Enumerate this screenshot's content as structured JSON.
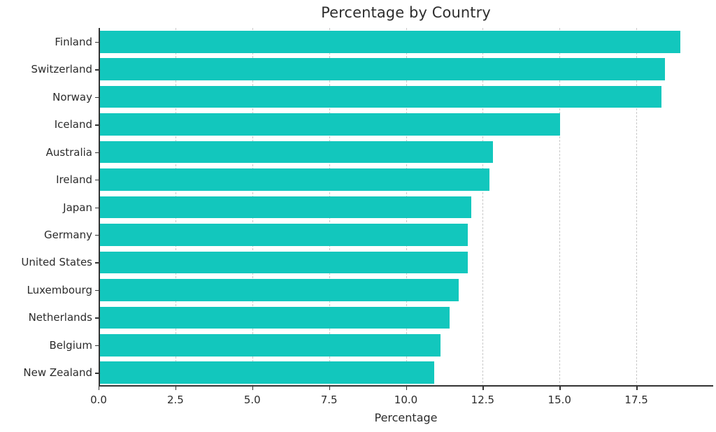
{
  "chart_data": {
    "type": "bar",
    "orientation": "horizontal",
    "title": "Percentage by Country",
    "xlabel": "Percentage",
    "ylabel": "",
    "categories": [
      "Finland",
      "Switzerland",
      "Norway",
      "Iceland",
      "Australia",
      "Ireland",
      "Japan",
      "Germany",
      "United States",
      "Luxembourg",
      "Netherlands",
      "Belgium",
      "New Zealand"
    ],
    "values": [
      18.9,
      18.4,
      18.3,
      15.0,
      12.8,
      12.7,
      12.1,
      12.0,
      12.0,
      11.7,
      11.4,
      11.1,
      10.9
    ],
    "xlim": [
      0,
      20.0
    ],
    "xticks": [
      0.0,
      2.5,
      5.0,
      7.5,
      10.0,
      12.5,
      15.0,
      17.5
    ],
    "xtick_labels": [
      "0.0",
      "2.5",
      "5.0",
      "7.5",
      "10.0",
      "12.5",
      "15.0",
      "17.5"
    ],
    "bar_color": "#12c7bd",
    "grid": "x-axis dashed vertical gridlines",
    "grid_color": "#c9c9c9",
    "legend": null,
    "legend_position": "none",
    "axis_color": "#333333",
    "background_color": "#ffffff",
    "text_color": "#2b2b2b"
  }
}
